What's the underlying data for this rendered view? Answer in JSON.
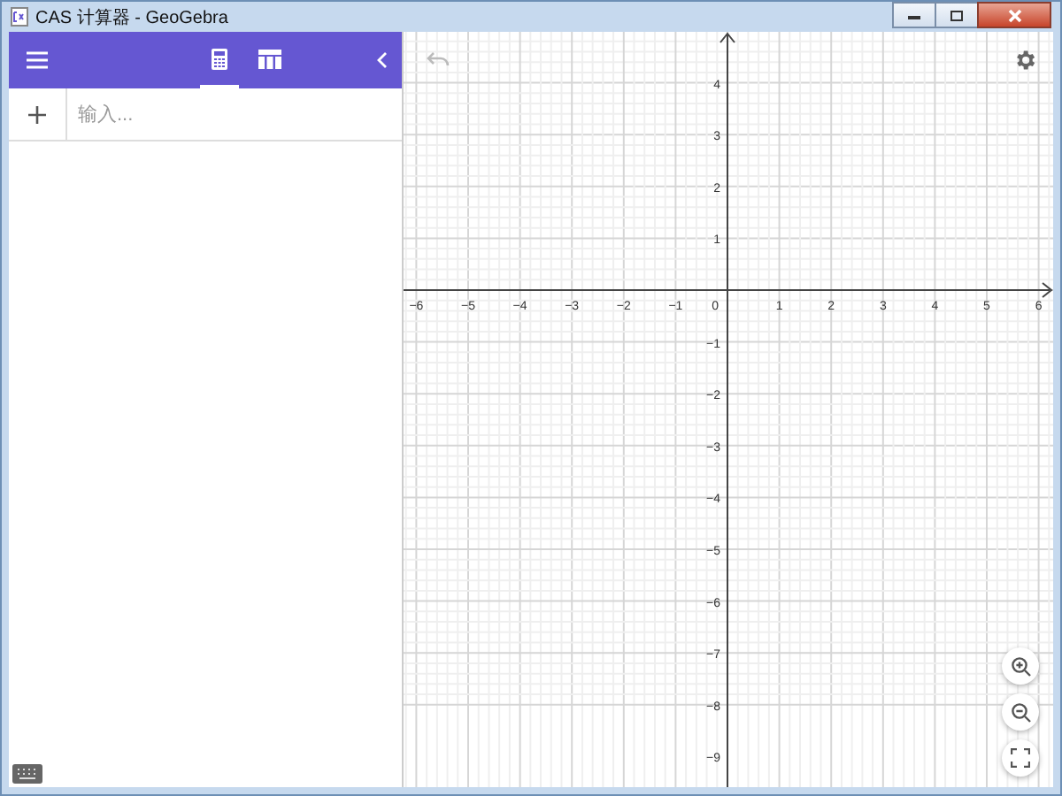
{
  "window": {
    "title": "CAS 计算器 - GeoGebra"
  },
  "tabs": [
    {
      "kind": "algebra",
      "selected": true
    },
    {
      "kind": "table",
      "selected": false
    }
  ],
  "input": {
    "placeholder": "输入..."
  },
  "graph": {
    "x_labels": [
      "−6",
      "−5",
      "−4",
      "−3",
      "−2",
      "−1",
      "1",
      "2",
      "3",
      "4",
      "5",
      "6"
    ],
    "origin_label": "0",
    "y_labels": [
      "4",
      "3",
      "2",
      "1",
      "−1",
      "−2",
      "−3",
      "−4",
      "−5",
      "−6",
      "−7",
      "−8",
      "−9"
    ]
  }
}
